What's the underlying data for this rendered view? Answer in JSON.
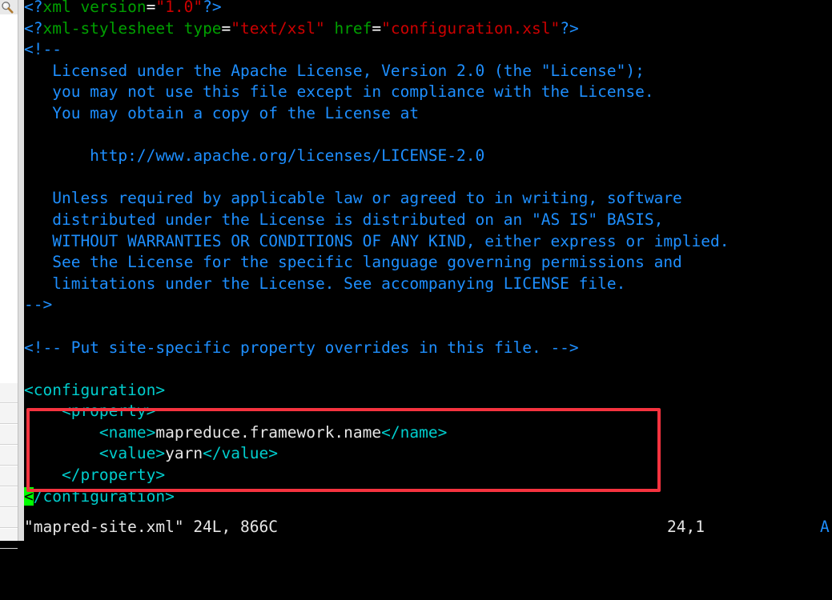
{
  "app": {
    "kind": "terminal-text-editor",
    "editor": "vim",
    "filename": "mapred-site.xml"
  },
  "colors": {
    "background": "#000000",
    "tag": "#00cdcd",
    "comment": "#1e8fff",
    "string": "#cc0000",
    "pi_name": "#00a000",
    "text": "#e6e6e6",
    "cursor": "#00ff00",
    "annotation": "#f5333f"
  },
  "icons": {
    "magnifier": "search-icon"
  },
  "editor": {
    "lines": [
      {
        "id": "l1",
        "tokens": [
          {
            "t": "<?",
            "c": "c-blue"
          },
          {
            "t": "xml version",
            "c": "c-green"
          },
          {
            "t": "=",
            "c": "c-eq"
          },
          {
            "t": "\"1.0\"",
            "c": "c-red"
          },
          {
            "t": "?>",
            "c": "c-blue"
          }
        ]
      },
      {
        "id": "l2",
        "tokens": [
          {
            "t": "<?",
            "c": "c-blue"
          },
          {
            "t": "xml-stylesheet type",
            "c": "c-green"
          },
          {
            "t": "=",
            "c": "c-eq"
          },
          {
            "t": "\"text/xsl\"",
            "c": "c-red"
          },
          {
            "t": " ",
            "c": "c-white"
          },
          {
            "t": "href",
            "c": "c-green"
          },
          {
            "t": "=",
            "c": "c-eq"
          },
          {
            "t": "\"configuration.xsl\"",
            "c": "c-red"
          },
          {
            "t": "?>",
            "c": "c-blue"
          }
        ]
      },
      {
        "id": "l3",
        "tokens": [
          {
            "t": "<!--",
            "c": "c-blue"
          }
        ]
      },
      {
        "id": "l4",
        "tokens": [
          {
            "t": "   Licensed under the Apache License, Version 2.0 (the \"License\");",
            "c": "c-comment"
          }
        ]
      },
      {
        "id": "l5",
        "tokens": [
          {
            "t": "   you may not use this file except in compliance with the License.",
            "c": "c-comment"
          }
        ]
      },
      {
        "id": "l6",
        "tokens": [
          {
            "t": "   You may obtain a copy of the License at",
            "c": "c-comment"
          }
        ]
      },
      {
        "id": "l7",
        "tokens": [
          {
            "t": "",
            "c": "c-comment"
          }
        ]
      },
      {
        "id": "l8",
        "tokens": [
          {
            "t": "       http://www.apache.org/licenses/LICENSE-2.0",
            "c": "c-comment"
          }
        ]
      },
      {
        "id": "l9",
        "tokens": [
          {
            "t": "",
            "c": "c-comment"
          }
        ]
      },
      {
        "id": "l10",
        "tokens": [
          {
            "t": "   Unless required by applicable law or agreed to in writing, software",
            "c": "c-comment"
          }
        ]
      },
      {
        "id": "l11",
        "tokens": [
          {
            "t": "   distributed under the License is distributed on an \"AS IS\" BASIS,",
            "c": "c-comment"
          }
        ]
      },
      {
        "id": "l12",
        "tokens": [
          {
            "t": "   WITHOUT WARRANTIES OR CONDITIONS OF ANY KIND, either express or implied.",
            "c": "c-comment"
          }
        ]
      },
      {
        "id": "l13",
        "tokens": [
          {
            "t": "   See the License for the specific language governing permissions and",
            "c": "c-comment"
          }
        ]
      },
      {
        "id": "l14",
        "tokens": [
          {
            "t": "   limitations under the License. See accompanying LICENSE file.",
            "c": "c-comment"
          }
        ]
      },
      {
        "id": "l15",
        "tokens": [
          {
            "t": "-->",
            "c": "c-blue"
          }
        ]
      },
      {
        "id": "l16",
        "tokens": [
          {
            "t": "",
            "c": "c-white"
          }
        ]
      },
      {
        "id": "l17",
        "tokens": [
          {
            "t": "<!-- Put site-specific property overrides in this file. -->",
            "c": "c-comment"
          }
        ]
      },
      {
        "id": "l18",
        "tokens": [
          {
            "t": "",
            "c": "c-white"
          }
        ]
      },
      {
        "id": "l19",
        "tokens": [
          {
            "t": "<configuration>",
            "c": "c-cyan"
          }
        ]
      },
      {
        "id": "l20",
        "tokens": [
          {
            "t": "    <property>",
            "c": "c-cyan"
          }
        ]
      },
      {
        "id": "l21",
        "tokens": [
          {
            "t": "        <name>",
            "c": "c-cyan"
          },
          {
            "t": "mapreduce.framework.name",
            "c": "c-white"
          },
          {
            "t": "</name>",
            "c": "c-cyan"
          }
        ]
      },
      {
        "id": "l22",
        "tokens": [
          {
            "t": "        <value>",
            "c": "c-cyan"
          },
          {
            "t": "yarn",
            "c": "c-white"
          },
          {
            "t": "</value>",
            "c": "c-cyan"
          }
        ]
      },
      {
        "id": "l23",
        "tokens": [
          {
            "t": "    </property>",
            "c": "c-cyan"
          }
        ]
      },
      {
        "id": "l24",
        "tokens": [
          {
            "t": "<",
            "c": "cursor"
          },
          {
            "t": "/configuration>",
            "c": "c-cyan"
          }
        ]
      }
    ]
  },
  "statusline": {
    "file_message": "\"mapred-site.xml\" 24L, 866C",
    "cursor_position": "24,1",
    "scroll_percent": "A"
  },
  "annotation": {
    "label": "highlighted-property-block",
    "content_lines": [
      "    <property>",
      "        <name>mapreduce.framework.name</name>",
      "        <value>yarn</value>",
      "    </property>"
    ]
  }
}
